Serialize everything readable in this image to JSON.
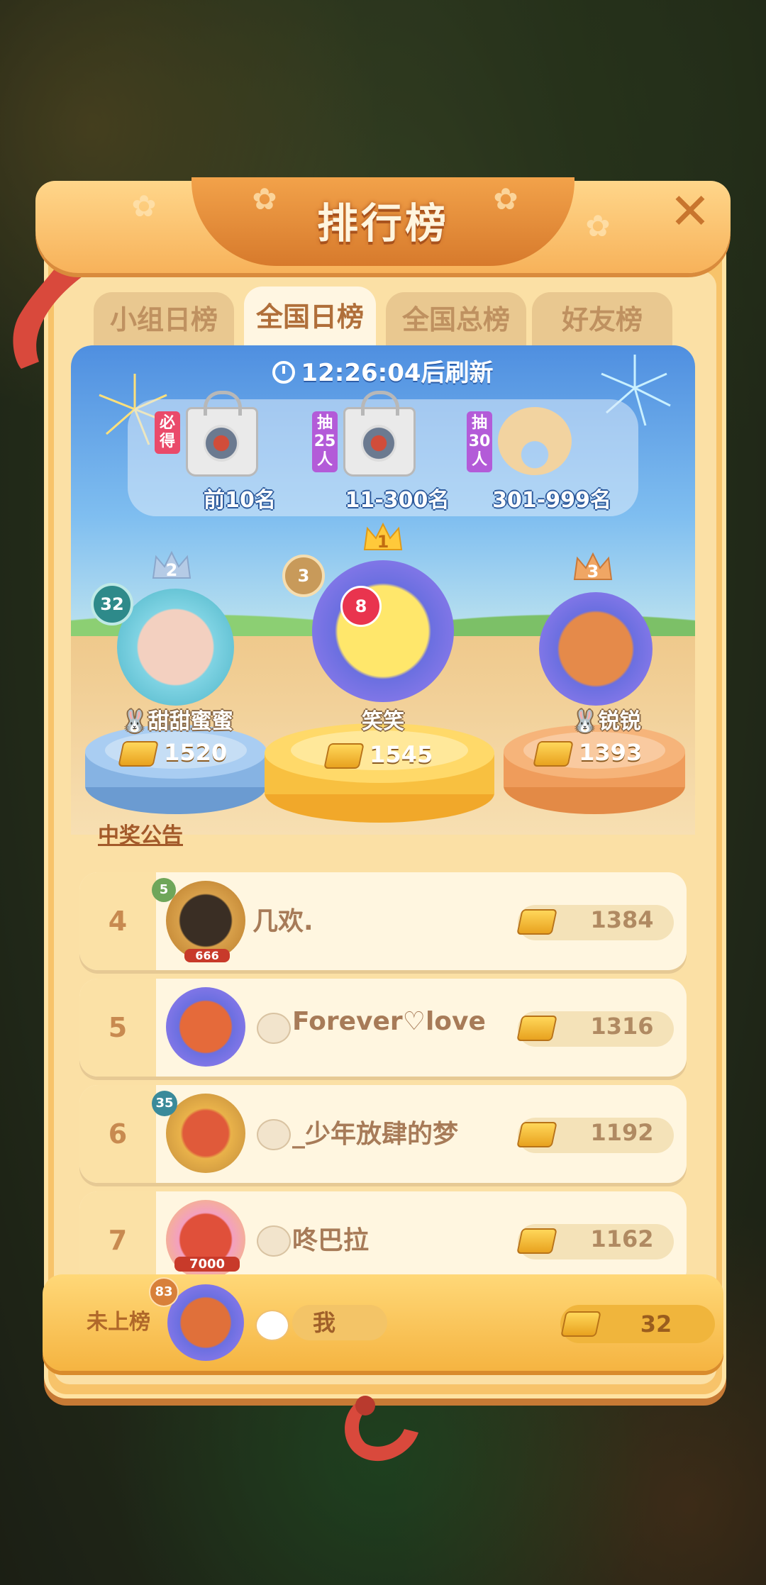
{
  "panel": {
    "title": "排行榜"
  },
  "tabs": [
    {
      "label": "小组日榜"
    },
    {
      "label": "全国日榜"
    },
    {
      "label": "全国总榜"
    },
    {
      "label": "好友榜"
    }
  ],
  "timer": {
    "text": "12:26:04后刷新"
  },
  "rewards": [
    {
      "tag": "必得",
      "label": "前10名",
      "item": "bag-icon"
    },
    {
      "tag": "抽25人",
      "label": "11-300名",
      "item": "bag-icon"
    },
    {
      "tag": "抽30人",
      "label": "301-999名",
      "item": "pillow-icon"
    }
  ],
  "podium": {
    "first": {
      "rank": "1",
      "level": "3",
      "badge": "8",
      "name": "笑笑",
      "score": "1545"
    },
    "second": {
      "rank": "2",
      "level": "32",
      "name": "甜甜蜜蜜",
      "score": "1520"
    },
    "third": {
      "rank": "3",
      "name": "锐锐",
      "score": "1393"
    }
  },
  "announcement": "中奖公告",
  "list": [
    {
      "rank": "4",
      "level": "5",
      "frame_text": "666",
      "name": "几欢.",
      "score": "1384"
    },
    {
      "rank": "5",
      "name": "Forever♡love",
      "score": "1316"
    },
    {
      "rank": "6",
      "level": "35",
      "name": "_少年放肆的梦",
      "score": "1192"
    },
    {
      "rank": "7",
      "frame_text": "7000",
      "name": "咚巴拉",
      "score": "1162"
    }
  ],
  "me": {
    "rank_label": "未上榜",
    "level": "83",
    "name": "我",
    "score": "32"
  },
  "colors": {
    "stage_blue": "#4f8fe0",
    "gold": "#f5b441",
    "orange": "#d77a2c"
  }
}
